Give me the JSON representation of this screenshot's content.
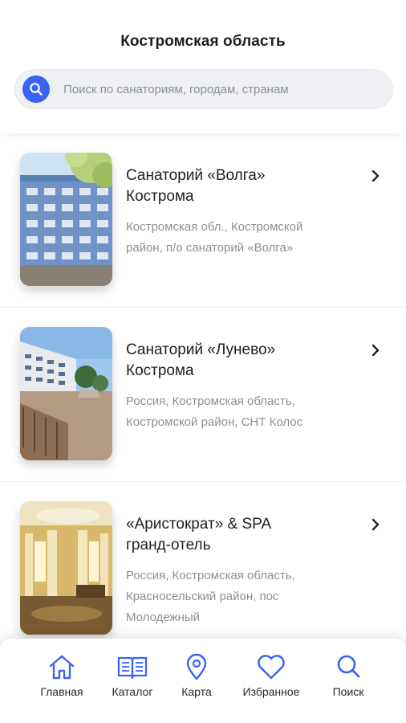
{
  "header": {
    "title": "Костромская область"
  },
  "search": {
    "placeholder": "Поиск по санаториям, городам, странам",
    "value": ""
  },
  "items": [
    {
      "name_line1": "Санаторий «Волга»",
      "name_line2": "Кострома",
      "address": "Костромская обл., Костромской район, п/о санаторий «Волга»"
    },
    {
      "name_line1": "Санаторий «Лунево»",
      "name_line2": "Кострома",
      "address": "Россия, Костромская область, Костромской район, СНТ Колос"
    },
    {
      "name_line1": "«Аристократ» & SPA",
      "name_line2": "гранд-отель",
      "address": "Россия, Костромская область, Красносельский район, пос Молодежный"
    }
  ],
  "tabbar": {
    "tabs": [
      {
        "label": "Главная",
        "icon": "home-icon"
      },
      {
        "label": "Каталог",
        "icon": "catalog-icon"
      },
      {
        "label": "Карта",
        "icon": "map-pin-icon"
      },
      {
        "label": "Избранное",
        "icon": "heart-icon"
      },
      {
        "label": "Поиск",
        "icon": "search-icon"
      }
    ]
  },
  "colors": {
    "accent": "#3b63f2",
    "text": "#1f1f1f",
    "muted": "#8f8f8f",
    "search_bg": "#eef0f4"
  }
}
